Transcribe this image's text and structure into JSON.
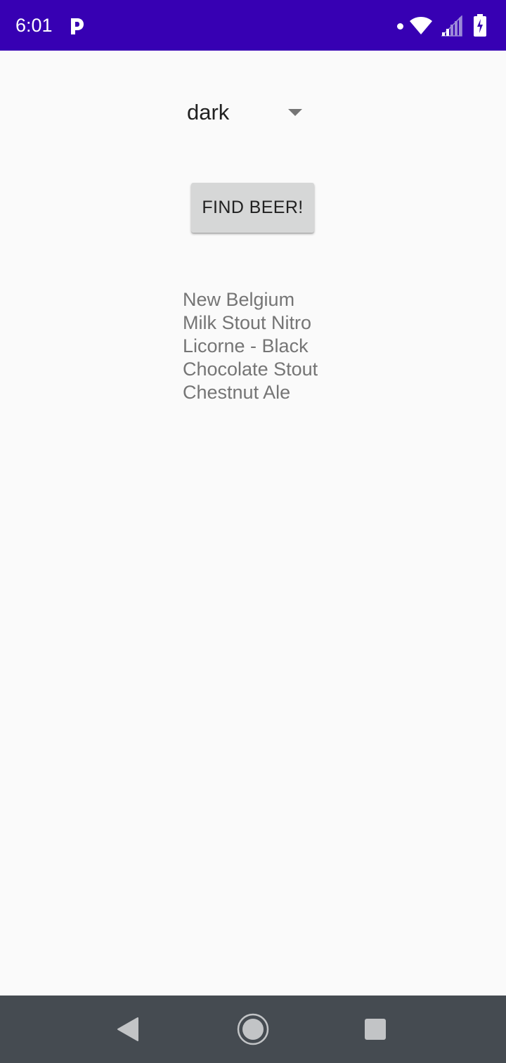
{
  "status_bar": {
    "time": "6:01",
    "icons": [
      "parking-icon",
      "notification-dot-icon",
      "wifi-icon",
      "cell-signal-icon",
      "battery-charging-icon"
    ],
    "background_color": "#3700b3"
  },
  "spinner": {
    "selected_value": "dark"
  },
  "find_button": {
    "label": "FIND BEER!"
  },
  "results": [
    "New Belgium",
    "Milk Stout Nitro",
    "Licorne - Black",
    "Chocolate Stout",
    "Chestnut Ale"
  ],
  "nav_bar": {
    "buttons": [
      "back-icon",
      "home-icon",
      "recents-icon"
    ],
    "background_color": "#454b51"
  }
}
